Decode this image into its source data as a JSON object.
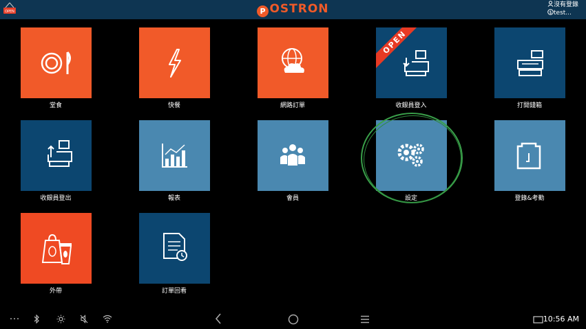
{
  "header": {
    "logo_text": "OSTRON",
    "logo_mark": "P",
    "user_status": "沒有登錄",
    "user_account": "test..."
  },
  "tiles": [
    {
      "label": "堂食",
      "icon": "dine-in-icon",
      "color": "#f15a29"
    },
    {
      "label": "快餐",
      "icon": "lightning-icon",
      "color": "#f15a29"
    },
    {
      "label": "網路訂單",
      "icon": "cloud-globe-icon",
      "color": "#f15a29"
    },
    {
      "label": "收銀員登入",
      "icon": "cashier-login-icon",
      "color": "#0c4670",
      "ribbon": "OPEN"
    },
    {
      "label": "打開錢箱",
      "icon": "cash-drawer-icon",
      "color": "#0c4670"
    },
    {
      "label": "收銀員登出",
      "icon": "cashier-logout-icon",
      "color": "#0c4670"
    },
    {
      "label": "報表",
      "icon": "report-chart-icon",
      "color": "#4a88b0"
    },
    {
      "label": "會員",
      "icon": "members-icon",
      "color": "#4a88b0"
    },
    {
      "label": "設定",
      "icon": "gears-icon",
      "color": "#4a88b0"
    },
    {
      "label": "登錄&考勤",
      "icon": "attendance-icon",
      "color": "#4a88b0"
    },
    {
      "label": "外帶",
      "icon": "takeaway-icon",
      "color": "#ef4a23"
    },
    {
      "label": "訂單回看",
      "icon": "order-review-icon",
      "color": "#0c4670"
    }
  ],
  "statusbar": {
    "time": "10:56 AM"
  }
}
